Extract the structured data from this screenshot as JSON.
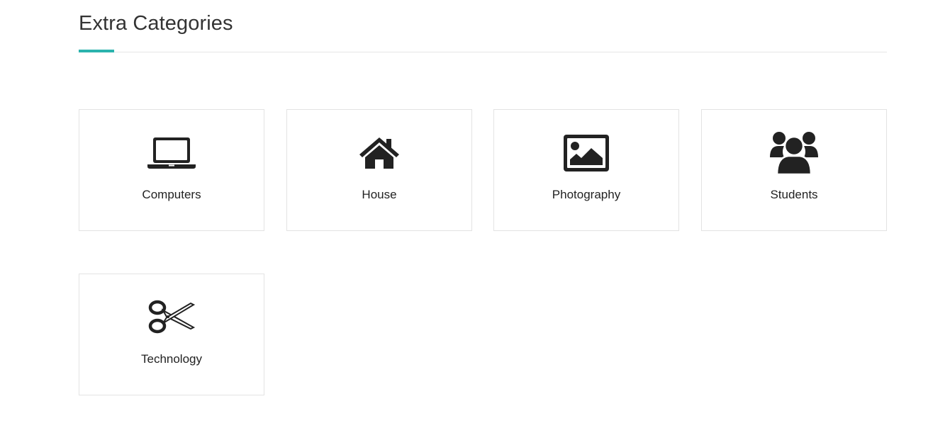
{
  "section": {
    "title": "Extra Categories",
    "accent_color": "#2bb3ad"
  },
  "categories": [
    {
      "label": "Computers",
      "icon": "laptop-icon"
    },
    {
      "label": "House",
      "icon": "house-icon"
    },
    {
      "label": "Photography",
      "icon": "image-icon"
    },
    {
      "label": "Students",
      "icon": "users-icon"
    },
    {
      "label": "Technology",
      "icon": "scissors-icon"
    }
  ]
}
